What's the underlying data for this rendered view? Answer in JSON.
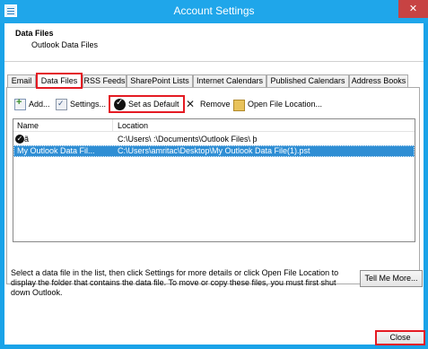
{
  "window": {
    "title": "Account Settings",
    "close_glyph": "✕",
    "accent_color": "#1fa6ea",
    "highlight_color": "#e41b23"
  },
  "header": {
    "title": "Data Files",
    "subtitle": "Outlook Data Files"
  },
  "tabs": [
    {
      "label": "Email",
      "active": false
    },
    {
      "label": "Data Files",
      "active": true
    },
    {
      "label": "RSS Feeds",
      "active": false
    },
    {
      "label": "SharePoint Lists",
      "active": false
    },
    {
      "label": "Internet Calendars",
      "active": false
    },
    {
      "label": "Published Calendars",
      "active": false
    },
    {
      "label": "Address Books",
      "active": false
    }
  ],
  "toolbar": {
    "add_label": "Add...",
    "settings_label": "Settings...",
    "set_default_label": "Set as Default",
    "remove_label": "Remove",
    "open_location_label": "Open File Location...",
    "icons": [
      "add-icon",
      "settings-icon",
      "set-default-icon",
      "remove-icon",
      "folder-icon"
    ]
  },
  "list": {
    "columns": [
      "Name",
      "Location"
    ],
    "rows": [
      {
        "name": "ã",
        "location": "C:\\Users\\       :\\Documents\\Outlook Files\\                þ",
        "is_default": true,
        "selected": false
      },
      {
        "name": "My Outlook Data Fil...",
        "location": "C:\\Users\\amritac\\Desktop\\My Outlook Data File(1).pst",
        "is_default": false,
        "selected": true
      }
    ]
  },
  "info_text": "Select a data file in the list, then click Settings for more details or click Open File Location to display the folder that contains the data file. To move or copy these files, you must first shut down Outlook.",
  "tell_me_label": "Tell Me More...",
  "close_label": "Close"
}
